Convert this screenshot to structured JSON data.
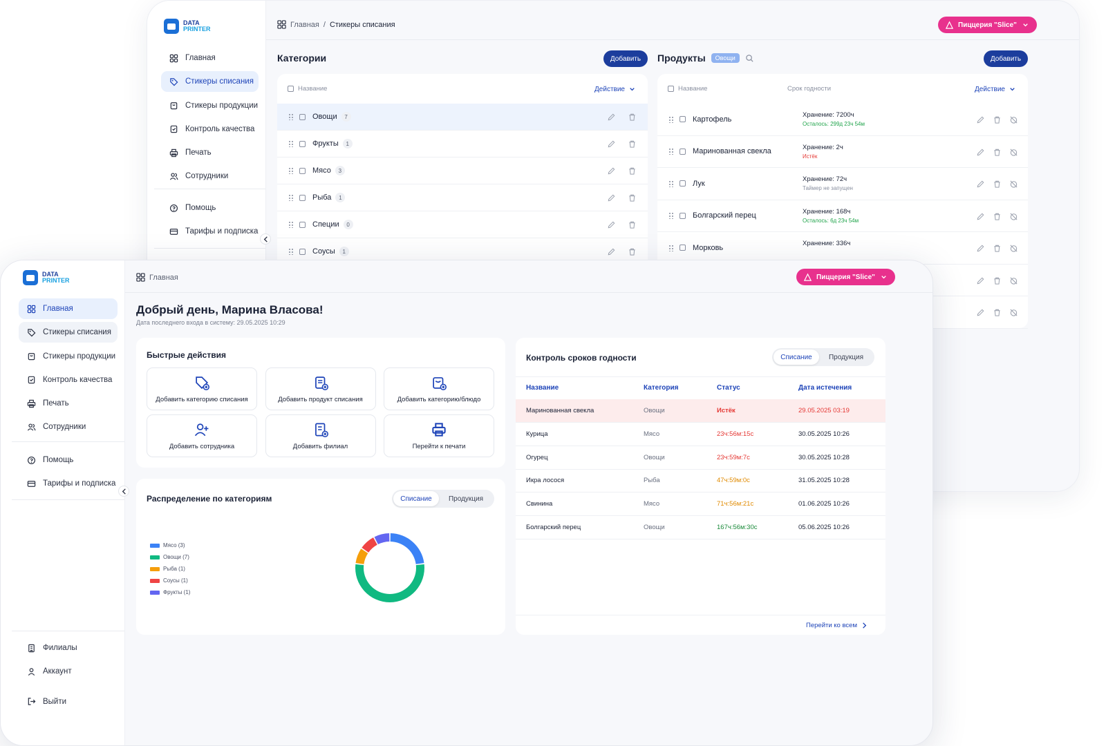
{
  "logo": {
    "line1": "DATA",
    "line2": "PRINTER"
  },
  "back": {
    "breadcrumb": {
      "home": "Главная",
      "sep": "/",
      "current": "Стикеры списания"
    },
    "pizzeria": "Пиццерия \"Slice\"",
    "nav": [
      {
        "label": "Главная",
        "icon": "grid-icon"
      },
      {
        "label": "Стикеры списания",
        "icon": "tag-icon"
      },
      {
        "label": "Стикеры продукции",
        "icon": "bag-icon"
      },
      {
        "label": "Контроль качества",
        "icon": "clipboard-check-icon"
      },
      {
        "label": "Печать",
        "icon": "printer-icon"
      },
      {
        "label": "Сотрудники",
        "icon": "users-icon"
      }
    ],
    "nav_bottom": [
      {
        "label": "Помощь",
        "icon": "help-icon"
      },
      {
        "label": "Тарифы и подписка",
        "icon": "card-icon"
      }
    ],
    "categories": {
      "title": "Категории",
      "add": "Добавить",
      "col_name": "Название",
      "action": "Действие",
      "rows": [
        {
          "name": "Овощи",
          "count": "7"
        },
        {
          "name": "Фрукты",
          "count": "1"
        },
        {
          "name": "Мясо",
          "count": "3"
        },
        {
          "name": "Рыба",
          "count": "1"
        },
        {
          "name": "Специи",
          "count": "0"
        },
        {
          "name": "Соусы",
          "count": "1"
        }
      ]
    },
    "products": {
      "title": "Продукты",
      "filter": "Овощи",
      "add": "Добавить",
      "col_name": "Название",
      "col_shelf": "Срок годности",
      "action": "Действие",
      "rows": [
        {
          "name": "Картофель",
          "storage": "Хранение: 7200ч",
          "status": "Осталось: 299д 23ч 54м",
          "status_color": "#1fa34a"
        },
        {
          "name": "Маринованная свекла",
          "storage": "Хранение: 2ч",
          "status": "Истёк",
          "status_color": "#e53935"
        },
        {
          "name": "Лук",
          "storage": "Хранение: 72ч",
          "status": "Таймер не запущен",
          "status_color": "#8a90a0"
        },
        {
          "name": "Болгарский перец",
          "storage": "Хранение: 168ч",
          "status": "Осталось: 6д 23ч 54м",
          "status_color": "#1fa34a"
        },
        {
          "name": "Морковь",
          "storage": "Хранение: 336ч",
          "status": "",
          "status_color": "#8a90a0"
        }
      ]
    }
  },
  "front": {
    "breadcrumb": {
      "home": "Главная"
    },
    "pizzeria": "Пиццерия \"Slice\"",
    "nav": [
      {
        "label": "Главная",
        "icon": "grid-icon"
      },
      {
        "label": "Стикеры списания",
        "icon": "tag-icon"
      },
      {
        "label": "Стикеры продукции",
        "icon": "bag-icon"
      },
      {
        "label": "Контроль качества",
        "icon": "clipboard-check-icon"
      },
      {
        "label": "Печать",
        "icon": "printer-icon"
      },
      {
        "label": "Сотрудники",
        "icon": "users-icon"
      }
    ],
    "nav_mid": [
      {
        "label": "Помощь",
        "icon": "help-icon"
      },
      {
        "label": "Тарифы и подписка",
        "icon": "card-icon"
      }
    ],
    "nav_bottom": [
      {
        "label": "Филиалы",
        "icon": "building-icon"
      },
      {
        "label": "Аккаунт",
        "icon": "user-icon"
      },
      {
        "label": "Выйти",
        "icon": "logout-icon"
      }
    ],
    "greeting": "Добрый день, Марина Власова!",
    "last_login": "Дата последнего входа в систему: 29.05.2025 10:29",
    "quick": {
      "title": "Быстрые действия",
      "items": [
        {
          "label": "Добавить категорию списания",
          "icon": "tag-plus-icon"
        },
        {
          "label": "Добавить продукт списания",
          "icon": "clipboard-plus-icon"
        },
        {
          "label": "Добавить категорию/блюдо",
          "icon": "bag-plus-icon"
        },
        {
          "label": "Добавить сотрудника",
          "icon": "user-plus-icon"
        },
        {
          "label": "Добавить филиал",
          "icon": "building-plus-icon"
        },
        {
          "label": "Перейти к печати",
          "icon": "printer-icon"
        }
      ]
    },
    "distribution": {
      "title": "Распределение по категориям",
      "tabs": [
        "Списание",
        "Продукция"
      ]
    },
    "expiry": {
      "title": "Контроль сроков годности",
      "tabs": [
        "Списание",
        "Продукция"
      ],
      "headers": [
        "Название",
        "Категория",
        "Статус",
        "Дата истечения"
      ],
      "rows": [
        {
          "name": "Маринованная свекла",
          "cat": "Овощи",
          "status": "Истёк",
          "date": "29.05.2025 03:19",
          "color": "#e53935",
          "highlight": true
        },
        {
          "name": "Курица",
          "cat": "Мясо",
          "status": "23ч:56м:15с",
          "date": "30.05.2025 10:26",
          "color": "#e53935",
          "highlight": false
        },
        {
          "name": "Огурец",
          "cat": "Овощи",
          "status": "23ч:59м:7с",
          "date": "30.05.2025 10:28",
          "color": "#e53935",
          "highlight": false
        },
        {
          "name": "Икра лосося",
          "cat": "Рыба",
          "status": "47ч:59м:0с",
          "date": "31.05.2025 10:28",
          "color": "#e08a00",
          "highlight": false
        },
        {
          "name": "Свинина",
          "cat": "Мясо",
          "status": "71ч:56м:21с",
          "date": "01.06.2025 10:26",
          "color": "#e08a00",
          "highlight": false
        },
        {
          "name": "Болгарский перец",
          "cat": "Овощи",
          "status": "167ч:56м:30с",
          "date": "05.06.2025 10:26",
          "color": "#1a8a3a",
          "highlight": false
        }
      ],
      "see_all": "Перейти ко всем"
    }
  },
  "chart_data": {
    "type": "pie",
    "categories": [
      "Мясо (3)",
      "Овощи (7)",
      "Рыба (1)",
      "Соусы (1)",
      "Фрукты (1)"
    ],
    "values": [
      3,
      7,
      1,
      1,
      1
    ],
    "colors": [
      "#3b82f6",
      "#10b981",
      "#f59e0b",
      "#ef4444",
      "#6366f1"
    ],
    "donut": true,
    "legend": "left"
  }
}
